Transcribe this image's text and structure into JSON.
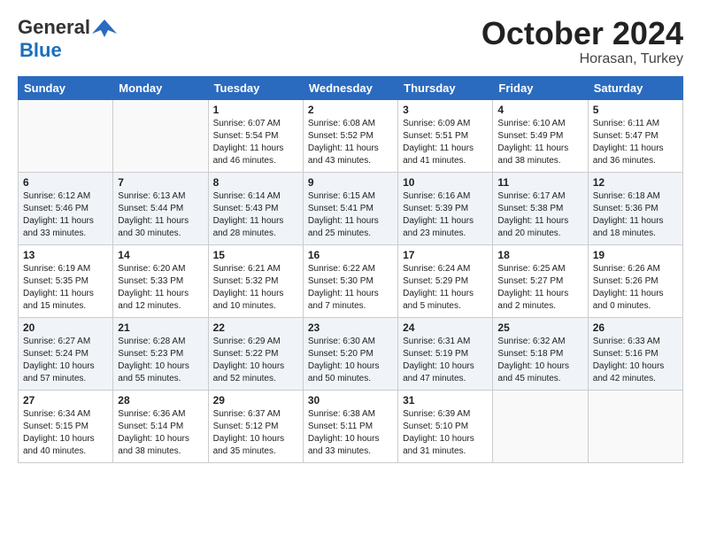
{
  "logo": {
    "general": "General",
    "blue": "Blue"
  },
  "title": "October 2024",
  "subtitle": "Horasan, Turkey",
  "days_header": [
    "Sunday",
    "Monday",
    "Tuesday",
    "Wednesday",
    "Thursday",
    "Friday",
    "Saturday"
  ],
  "weeks": [
    [
      {
        "day": "",
        "info": ""
      },
      {
        "day": "",
        "info": ""
      },
      {
        "day": "1",
        "info": "Sunrise: 6:07 AM\nSunset: 5:54 PM\nDaylight: 11 hours and 46 minutes."
      },
      {
        "day": "2",
        "info": "Sunrise: 6:08 AM\nSunset: 5:52 PM\nDaylight: 11 hours and 43 minutes."
      },
      {
        "day": "3",
        "info": "Sunrise: 6:09 AM\nSunset: 5:51 PM\nDaylight: 11 hours and 41 minutes."
      },
      {
        "day": "4",
        "info": "Sunrise: 6:10 AM\nSunset: 5:49 PM\nDaylight: 11 hours and 38 minutes."
      },
      {
        "day": "5",
        "info": "Sunrise: 6:11 AM\nSunset: 5:47 PM\nDaylight: 11 hours and 36 minutes."
      }
    ],
    [
      {
        "day": "6",
        "info": "Sunrise: 6:12 AM\nSunset: 5:46 PM\nDaylight: 11 hours and 33 minutes."
      },
      {
        "day": "7",
        "info": "Sunrise: 6:13 AM\nSunset: 5:44 PM\nDaylight: 11 hours and 30 minutes."
      },
      {
        "day": "8",
        "info": "Sunrise: 6:14 AM\nSunset: 5:43 PM\nDaylight: 11 hours and 28 minutes."
      },
      {
        "day": "9",
        "info": "Sunrise: 6:15 AM\nSunset: 5:41 PM\nDaylight: 11 hours and 25 minutes."
      },
      {
        "day": "10",
        "info": "Sunrise: 6:16 AM\nSunset: 5:39 PM\nDaylight: 11 hours and 23 minutes."
      },
      {
        "day": "11",
        "info": "Sunrise: 6:17 AM\nSunset: 5:38 PM\nDaylight: 11 hours and 20 minutes."
      },
      {
        "day": "12",
        "info": "Sunrise: 6:18 AM\nSunset: 5:36 PM\nDaylight: 11 hours and 18 minutes."
      }
    ],
    [
      {
        "day": "13",
        "info": "Sunrise: 6:19 AM\nSunset: 5:35 PM\nDaylight: 11 hours and 15 minutes."
      },
      {
        "day": "14",
        "info": "Sunrise: 6:20 AM\nSunset: 5:33 PM\nDaylight: 11 hours and 12 minutes."
      },
      {
        "day": "15",
        "info": "Sunrise: 6:21 AM\nSunset: 5:32 PM\nDaylight: 11 hours and 10 minutes."
      },
      {
        "day": "16",
        "info": "Sunrise: 6:22 AM\nSunset: 5:30 PM\nDaylight: 11 hours and 7 minutes."
      },
      {
        "day": "17",
        "info": "Sunrise: 6:24 AM\nSunset: 5:29 PM\nDaylight: 11 hours and 5 minutes."
      },
      {
        "day": "18",
        "info": "Sunrise: 6:25 AM\nSunset: 5:27 PM\nDaylight: 11 hours and 2 minutes."
      },
      {
        "day": "19",
        "info": "Sunrise: 6:26 AM\nSunset: 5:26 PM\nDaylight: 11 hours and 0 minutes."
      }
    ],
    [
      {
        "day": "20",
        "info": "Sunrise: 6:27 AM\nSunset: 5:24 PM\nDaylight: 10 hours and 57 minutes."
      },
      {
        "day": "21",
        "info": "Sunrise: 6:28 AM\nSunset: 5:23 PM\nDaylight: 10 hours and 55 minutes."
      },
      {
        "day": "22",
        "info": "Sunrise: 6:29 AM\nSunset: 5:22 PM\nDaylight: 10 hours and 52 minutes."
      },
      {
        "day": "23",
        "info": "Sunrise: 6:30 AM\nSunset: 5:20 PM\nDaylight: 10 hours and 50 minutes."
      },
      {
        "day": "24",
        "info": "Sunrise: 6:31 AM\nSunset: 5:19 PM\nDaylight: 10 hours and 47 minutes."
      },
      {
        "day": "25",
        "info": "Sunrise: 6:32 AM\nSunset: 5:18 PM\nDaylight: 10 hours and 45 minutes."
      },
      {
        "day": "26",
        "info": "Sunrise: 6:33 AM\nSunset: 5:16 PM\nDaylight: 10 hours and 42 minutes."
      }
    ],
    [
      {
        "day": "27",
        "info": "Sunrise: 6:34 AM\nSunset: 5:15 PM\nDaylight: 10 hours and 40 minutes."
      },
      {
        "day": "28",
        "info": "Sunrise: 6:36 AM\nSunset: 5:14 PM\nDaylight: 10 hours and 38 minutes."
      },
      {
        "day": "29",
        "info": "Sunrise: 6:37 AM\nSunset: 5:12 PM\nDaylight: 10 hours and 35 minutes."
      },
      {
        "day": "30",
        "info": "Sunrise: 6:38 AM\nSunset: 5:11 PM\nDaylight: 10 hours and 33 minutes."
      },
      {
        "day": "31",
        "info": "Sunrise: 6:39 AM\nSunset: 5:10 PM\nDaylight: 10 hours and 31 minutes."
      },
      {
        "day": "",
        "info": ""
      },
      {
        "day": "",
        "info": ""
      }
    ]
  ]
}
